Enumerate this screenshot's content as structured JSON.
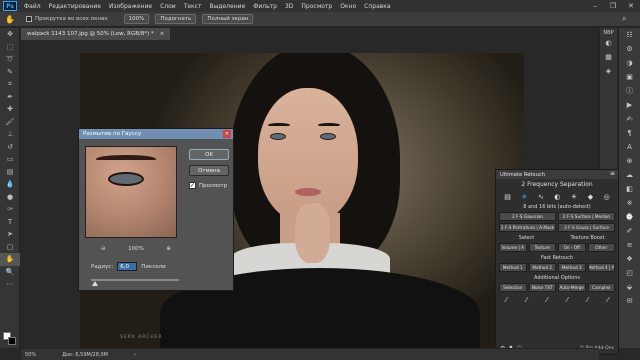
{
  "menubar": {
    "logo": "Ps",
    "items": [
      "Файл",
      "Редактирование",
      "Изображение",
      "Слои",
      "Текст",
      "Выделение",
      "Фильтр",
      "3D",
      "Просмотр",
      "Окно",
      "Справка"
    ]
  },
  "options": {
    "scroll_all_label": "Прокрутка во всех окнах",
    "zoom_value": "100%",
    "fit_label": "Подогнать",
    "fullscreen_label": "Полный экран"
  },
  "document_tab": {
    "title": "walpack 1143 107.jpg @ 50% (Low, RGB/8*) *",
    "close": "×"
  },
  "photo": {
    "watermark": "SERK ARCHER"
  },
  "gaussian_dialog": {
    "title": "Размытие по Гауссу",
    "ok_label": "OK",
    "cancel_label": "Отмена",
    "preview_label": "Просмотр",
    "preview_checked": true,
    "zoom_out": "⊖",
    "zoom_value": "100%",
    "zoom_in": "⊕",
    "radius_label": "Радиус:",
    "radius_value": "6,0",
    "radius_unit": "Пиксели"
  },
  "dock": {
    "nbp_label": "NBP"
  },
  "ultimate_retouch": {
    "title": "Ultimate Retouch",
    "header": "2 Frequency Separation",
    "bits_note": "8 and 16 bits (auto-detect)",
    "row1": [
      "2 F-S Gaussian",
      "2 F-S Surface | Median"
    ],
    "row2": [
      "2 F-S Portraiture | A-Mask",
      "3 F-S Gauss | Surface"
    ],
    "section_select": "Select",
    "section_texture": "Texture Boost",
    "select_buttons": [
      "Volume | A",
      "Texture",
      "On - Off",
      "Other"
    ],
    "section_fast": "Fast Retouch",
    "fast_buttons": [
      "Method 1",
      "Method 2",
      "Method 3",
      "Method 4 | A"
    ],
    "section_additional": "Additional Options",
    "additional_buttons": [
      "Selection",
      "Noise TXT",
      "Auto-Merge",
      "Complex"
    ],
    "footer_brand": "© Pro Add-Ons"
  },
  "status": {
    "zoom": "50%",
    "doc_info": "Док: 6,59M/28,0M"
  }
}
